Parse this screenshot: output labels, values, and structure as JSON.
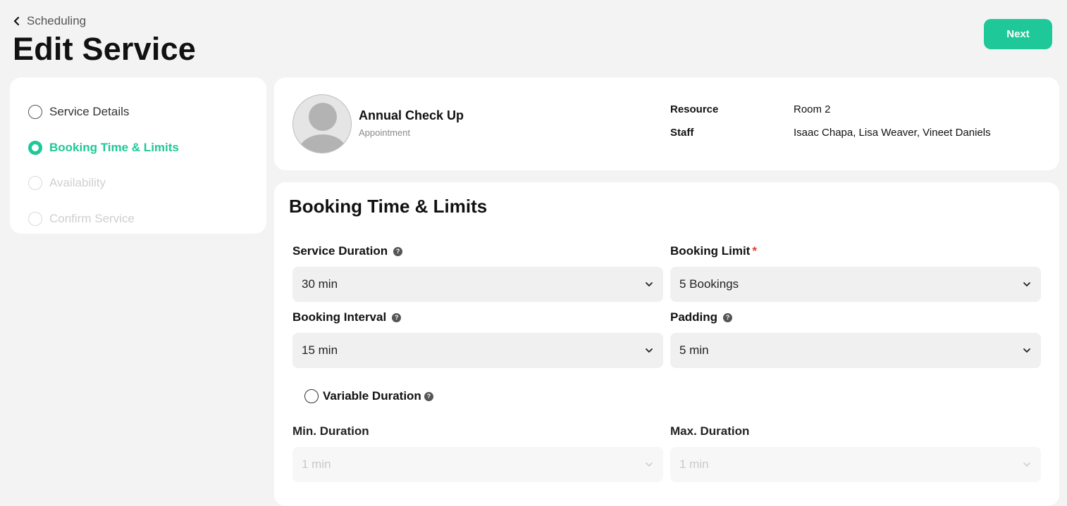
{
  "header": {
    "back_label": "Scheduling",
    "title": "Edit Service",
    "next_label": "Next"
  },
  "steps": [
    {
      "label": "Service Details",
      "state": "done"
    },
    {
      "label": "Booking Time & Limits",
      "state": "active"
    },
    {
      "label": "Availability",
      "state": "pending"
    },
    {
      "label": "Confirm Service",
      "state": "pending"
    }
  ],
  "summary": {
    "service_name": "Annual Check Up",
    "service_type": "Appointment",
    "resource_label": "Resource",
    "resource_value": "Room 2",
    "staff_label": "Staff",
    "staff_value": "Isaac Chapa, Lisa Weaver, Vineet Daniels"
  },
  "form": {
    "title": "Booking Time & Limits",
    "service_duration": {
      "label": "Service Duration",
      "value": "30 min"
    },
    "booking_limit": {
      "label": "Booking Limit",
      "required_mark": "*",
      "value": "5 Bookings"
    },
    "booking_interval": {
      "label": "Booking Interval",
      "value": "15 min"
    },
    "padding": {
      "label": "Padding",
      "value": "5 min"
    },
    "variable_duration": {
      "label": "Variable Duration",
      "checked": false
    },
    "min_duration": {
      "label": "Min. Duration",
      "value": "1 min"
    },
    "max_duration": {
      "label": "Max. Duration",
      "value": "1 min"
    }
  },
  "colors": {
    "accent": "#1ec898",
    "background": "#f3f3f3",
    "required": "#e53935"
  },
  "icons": {
    "back": "chevron-left-icon",
    "dropdown": "chevron-down-icon",
    "help": "question-circle-icon",
    "avatar": "user-avatar-icon"
  }
}
